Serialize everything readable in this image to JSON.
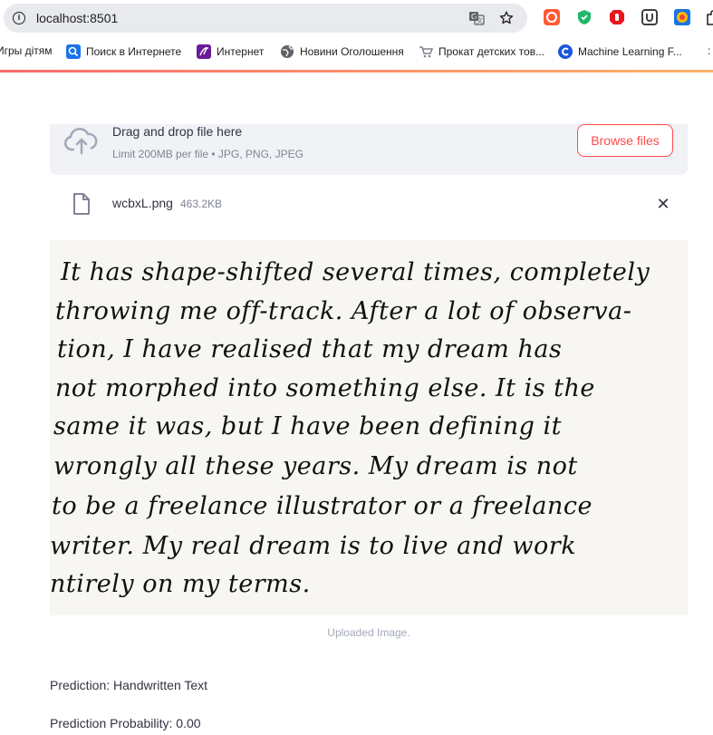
{
  "browser": {
    "url": "localhost:8501",
    "bookmarks": [
      {
        "label": "Игры дітям",
        "icon": "game-icon"
      },
      {
        "label": "Поиск в Интернете",
        "icon": "search-icon"
      },
      {
        "label": "Интернет",
        "icon": "internet-icon"
      },
      {
        "label": "Новини Оголошення",
        "icon": "globe-icon"
      },
      {
        "label": "Прокат детских тов...",
        "icon": "cart-icon"
      },
      {
        "label": "Machine Learning F...",
        "icon": "c-logo-icon"
      }
    ]
  },
  "uploader": {
    "drag_text": "Drag and drop file here",
    "limit_text": "Limit 200MB per file • JPG, PNG, JPEG",
    "browse_label": "Browse files"
  },
  "file": {
    "name": "wcbxL.png",
    "size": "463.2KB"
  },
  "image": {
    "handwritten_lines": [
      "It has shape-shifted several times, completely",
      "throwing me off-track. After a lot of observa-",
      "tion, I have realised that my dream has",
      "not morphed into something else. It is the",
      "same it was, but I have been defining it",
      "wrongly all these years. My dream is not",
      "to be a freelance illustrator or a freelance",
      "writer. My real dream is to live and work",
      "ntirely on my terms."
    ],
    "caption": "Uploaded Image."
  },
  "results": {
    "prediction": "Prediction: Handwritten Text",
    "probability": "Prediction Probability: 0.00"
  },
  "colors": {
    "accent": "#ff4b4b",
    "uploader_bg": "#f0f2f6",
    "text": "#31333f",
    "muted": "#808495"
  }
}
